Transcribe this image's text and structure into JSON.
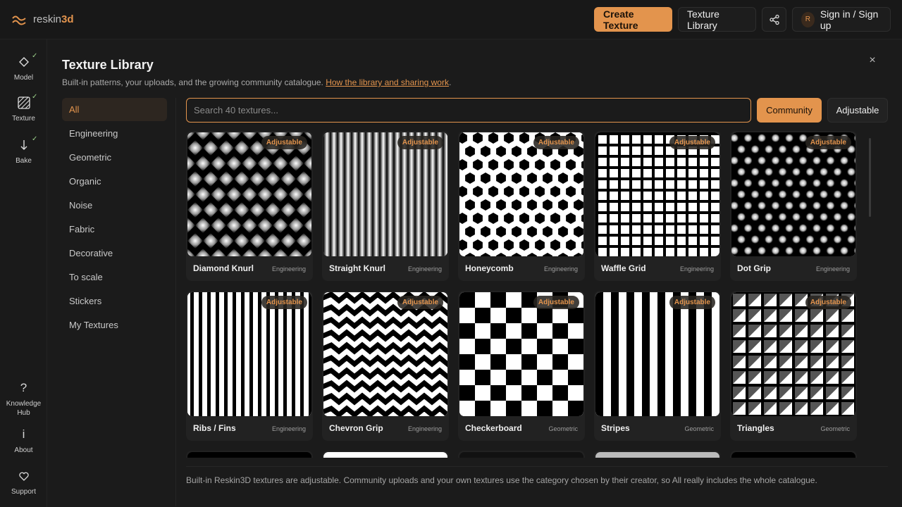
{
  "brand": {
    "prefix": "reskin",
    "suffix": "3d",
    "accent": "#e3944d"
  },
  "header": {
    "create_label": "Create Texture",
    "library_label": "Texture Library",
    "share_icon": "share-icon",
    "avatar_initial": "R",
    "signin_label": "Sign in / Sign up"
  },
  "rail": {
    "model": "Model",
    "texture": "Texture",
    "bake": "Bake",
    "knowledge_line1": "Knowledge",
    "knowledge_line2": "Hub",
    "about": "About",
    "support": "Support",
    "check": "✓"
  },
  "panel": {
    "title": "Texture Library",
    "subtitle": "Built-in patterns, your uploads, and the growing community catalogue.",
    "subtitle_link": "How the library and sharing work",
    "subtitle_end": ".",
    "close": "×"
  },
  "categories": [
    "All",
    "Engineering",
    "Geometric",
    "Organic",
    "Noise",
    "Fabric",
    "Decorative",
    "To scale",
    "Stickers",
    "My Textures"
  ],
  "search": {
    "placeholder": "Search 40 textures..."
  },
  "filters": {
    "community": "Community",
    "adjustable": "Adjustable"
  },
  "badge_label": "Adjustable",
  "textures": [
    {
      "name": "Diamond Knurl",
      "category": "Engineering",
      "pattern": "diamond"
    },
    {
      "name": "Straight Knurl",
      "category": "Engineering",
      "pattern": "straight"
    },
    {
      "name": "Honeycomb",
      "category": "Engineering",
      "pattern": "honeycomb"
    },
    {
      "name": "Waffle Grid",
      "category": "Engineering",
      "pattern": "waffle"
    },
    {
      "name": "Dot Grip",
      "category": "Engineering",
      "pattern": "dots"
    },
    {
      "name": "Ribs / Fins",
      "category": "Engineering",
      "pattern": "ribs"
    },
    {
      "name": "Chevron Grip",
      "category": "Engineering",
      "pattern": "chevron"
    },
    {
      "name": "Checkerboard",
      "category": "Geometric",
      "pattern": "checker"
    },
    {
      "name": "Stripes",
      "category": "Geometric",
      "pattern": "stripes"
    },
    {
      "name": "Triangles",
      "category": "Geometric",
      "pattern": "triangles"
    }
  ],
  "footnote": "Built-in Reskin3D textures are adjustable. Community uploads and your own textures use the category chosen by their creator, so All really includes the whole catalogue."
}
